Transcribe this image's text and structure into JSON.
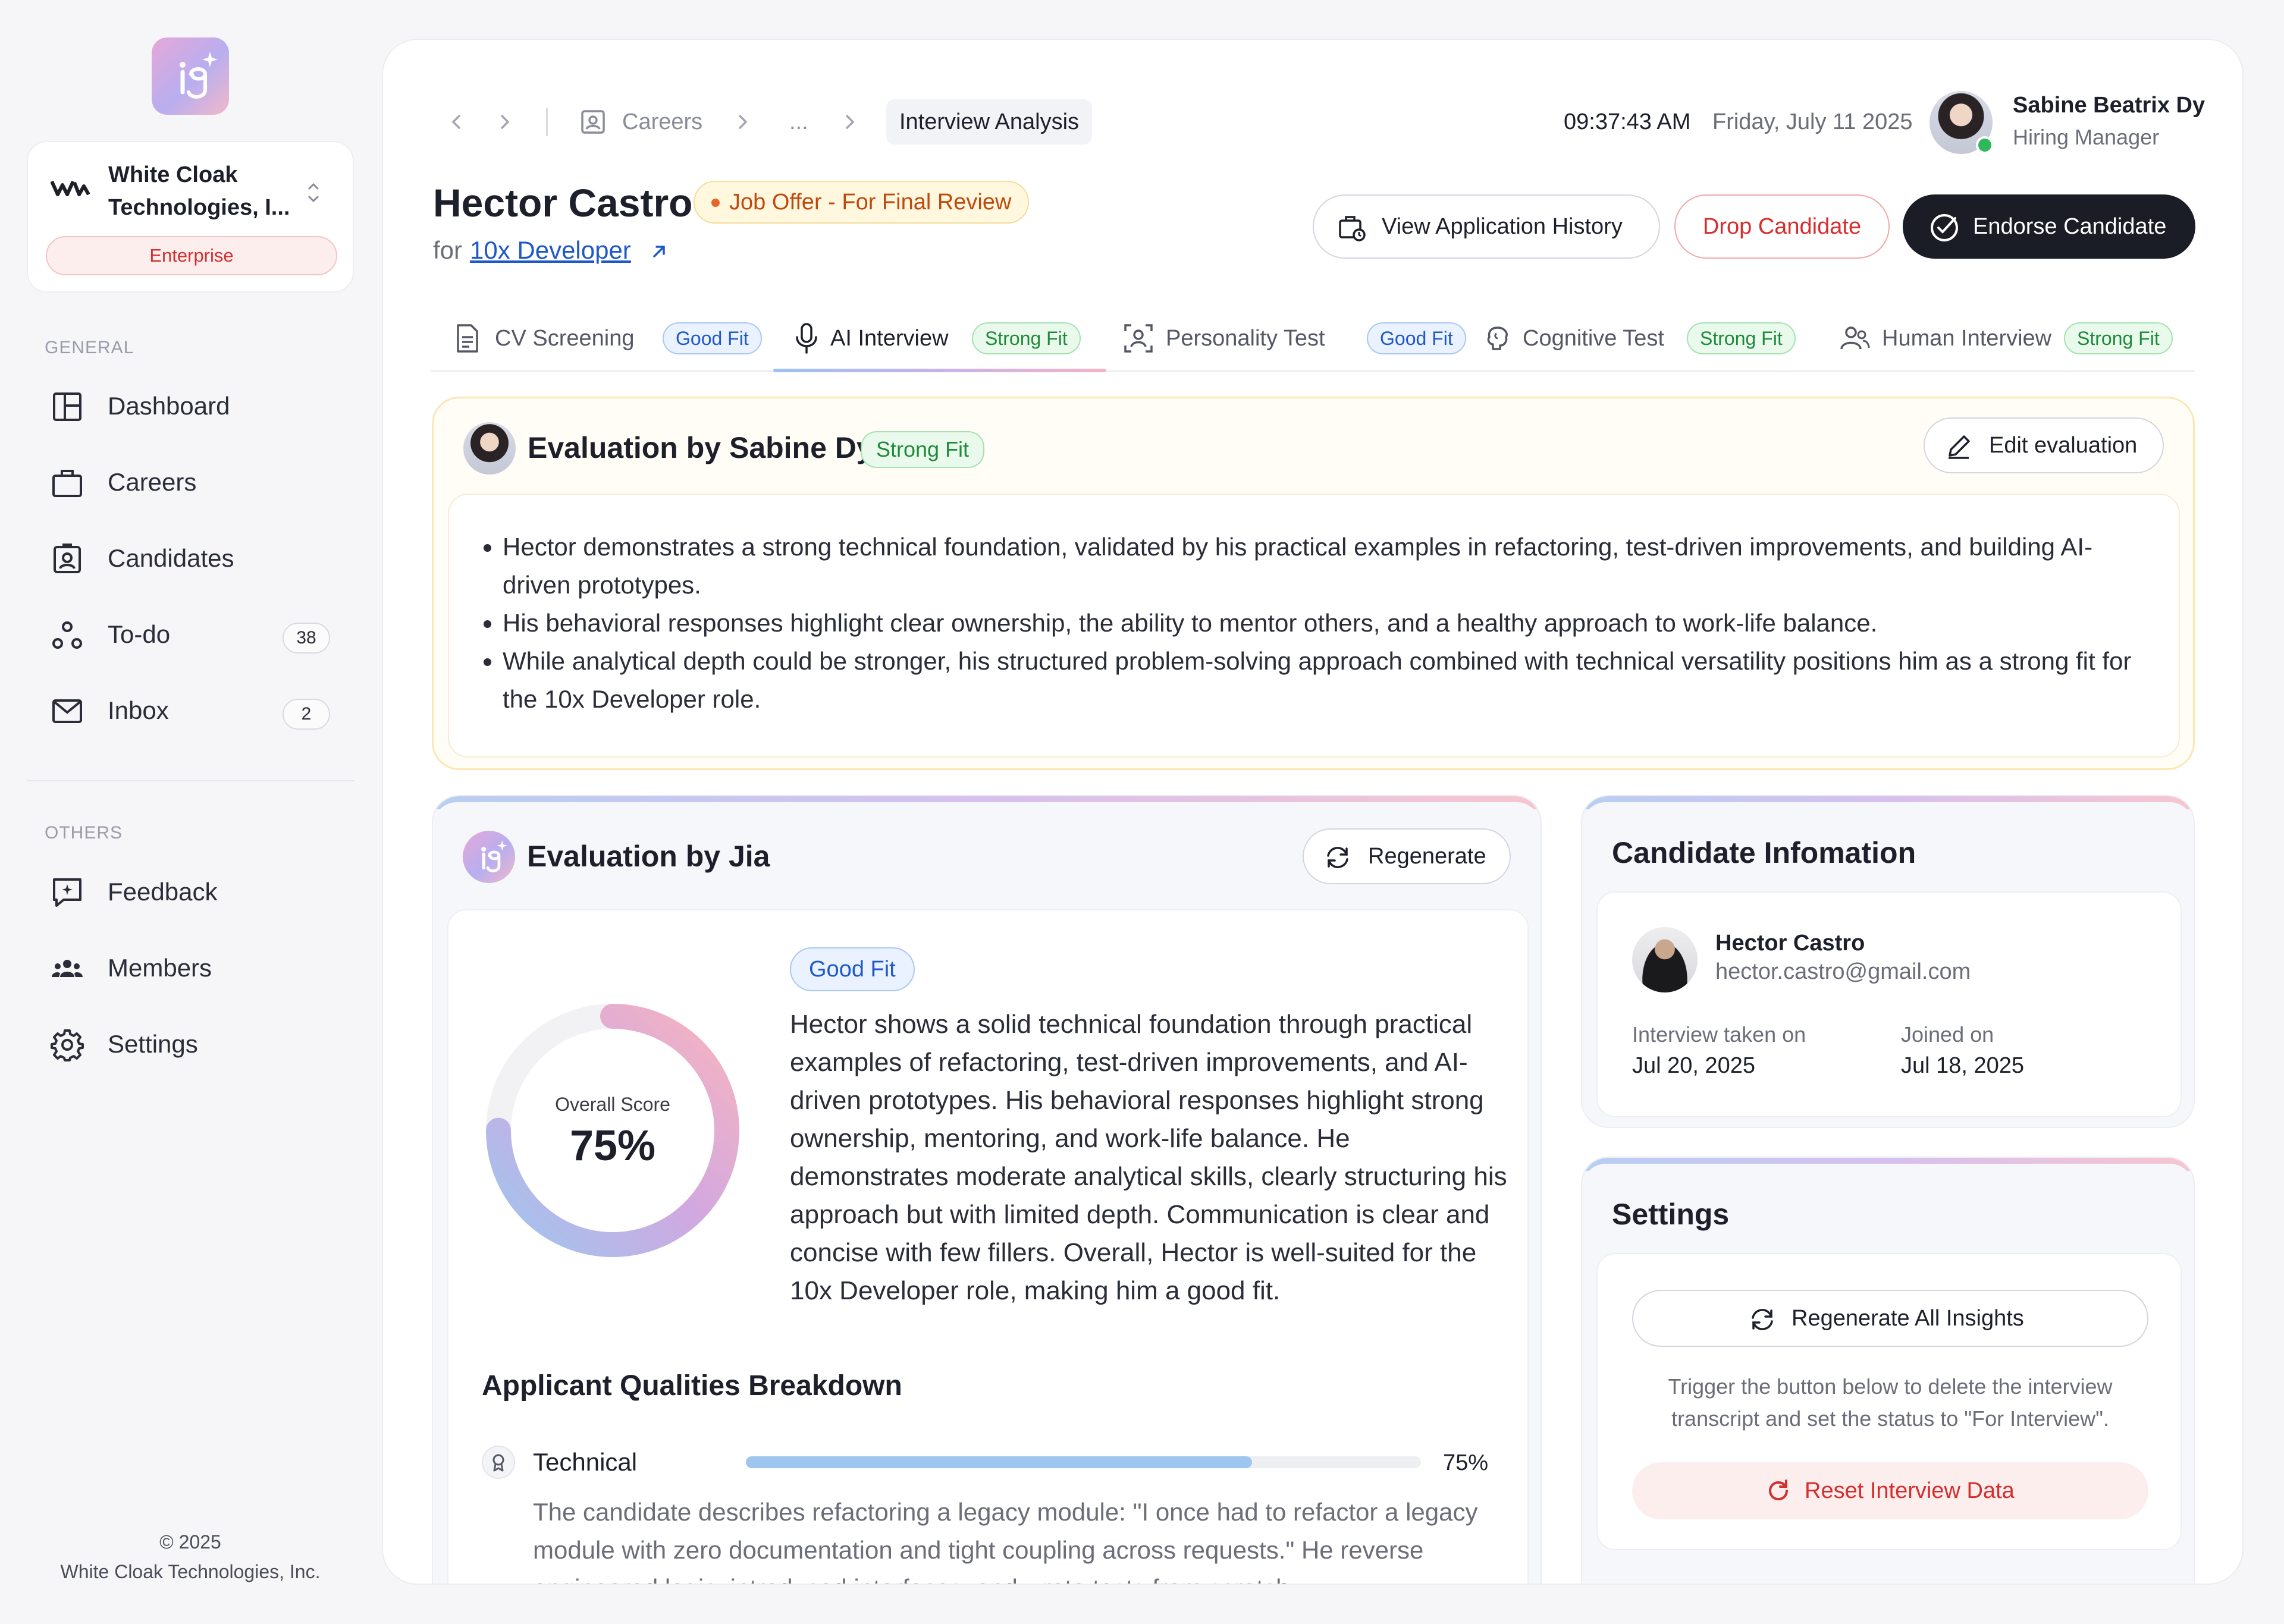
{
  "sidebar": {
    "org_name": "White Cloak Technologies, I...",
    "org_plan": "Enterprise",
    "general_label": "GENERAL",
    "others_label": "OTHERS",
    "general_items": [
      {
        "label": "Dashboard",
        "icon": "dashboard-icon"
      },
      {
        "label": "Careers",
        "icon": "briefcase-icon"
      },
      {
        "label": "Candidates",
        "icon": "candidates-icon"
      },
      {
        "label": "To-do",
        "icon": "todo-icon",
        "count": "38"
      },
      {
        "label": "Inbox",
        "icon": "mail-icon",
        "count": "2"
      }
    ],
    "other_items": [
      {
        "label": "Feedback",
        "icon": "feedback-icon"
      },
      {
        "label": "Members",
        "icon": "members-icon"
      },
      {
        "label": "Settings",
        "icon": "gear-icon"
      }
    ],
    "copyright_year": "© 2025",
    "copyright_company": "White Cloak Technologies, Inc."
  },
  "header": {
    "breadcrumb": [
      "Careers",
      "...",
      "Interview Analysis"
    ],
    "time": "09:37:43 AM",
    "date": "Friday, July 11 2025",
    "user_name": "Sabine Beatrix Dy",
    "user_role": "Hiring Manager"
  },
  "candidate": {
    "name": "Hector Castro",
    "status": "Job Offer - For Final Review",
    "for_label": "for",
    "role": "10x Developer"
  },
  "actions": {
    "history": "View Application History",
    "drop": "Drop Candidate",
    "endorse": "Endorse Candidate"
  },
  "tabs": [
    {
      "label": "CV Screening",
      "tag": "Good Fit",
      "icon": "document-icon"
    },
    {
      "label": "AI Interview",
      "tag": "Strong Fit",
      "icon": "microphone-icon"
    },
    {
      "label": "Personality Test",
      "tag": "Good Fit",
      "icon": "personality-icon"
    },
    {
      "label": "Cognitive Test",
      "tag": "Strong Fit",
      "icon": "brain-icon"
    },
    {
      "label": "Human Interview",
      "tag": "Strong Fit",
      "icon": "people-icon"
    }
  ],
  "evaluation_human": {
    "title": "Evaluation by Sabine Dy",
    "tag": "Strong Fit",
    "edit_label": "Edit evaluation",
    "bullets": [
      "Hector demonstrates a strong technical foundation, validated by his practical examples in refactoring, test-driven improvements, and building AI-driven prototypes.",
      "His behavioral responses highlight clear ownership, the ability to mentor others, and a healthy approach to work-life balance.",
      "While analytical depth could be stronger, his structured problem-solving approach combined with technical versatility positions him as a strong fit for the 10x Developer role."
    ]
  },
  "evaluation_ai": {
    "title": "Evaluation by Jia",
    "regenerate_label": "Regenerate",
    "tag": "Good Fit",
    "score_label": "Overall Score",
    "score_text": "75%",
    "score_value": 75,
    "summary": "Hector shows a solid technical foundation through practical examples of refactoring, test-driven improvements, and AI-driven prototypes. His behavioral responses highlight strong ownership, mentoring, and work-life balance. He demonstrates moderate analytical skills, clearly structuring his approach but with limited depth. Communication is clear and concise with few fillers. Overall, Hector is well-suited for the 10x Developer role, making him a good fit.",
    "breakdown_title": "Applicant Qualities Breakdown",
    "qualities": [
      {
        "label": "Technical",
        "percent_text": "75%",
        "percent": 75,
        "text": "The candidate describes refactoring a legacy module: \"I once had to refactor a legacy module with zero documentation and tight coupling across requests.\" He reverse engineered logic, introduced interfaces, and wrote tests from scratch."
      }
    ]
  },
  "candidate_info": {
    "title": "Candidate Infomation",
    "name": "Hector Castro",
    "email": "hector.castro@gmail.com",
    "interview_label": "Interview taken on",
    "interview_date": "Jul 20, 2025",
    "joined_label": "Joined on",
    "joined_date": "Jul 18, 2025"
  },
  "settings": {
    "title": "Settings",
    "regen_all": "Regenerate All Insights",
    "note": "Trigger the button below to delete the interview transcript and set the status to \"For Interview\".",
    "reset": "Reset Interview Data"
  },
  "colors": {
    "accent_blue": "#1f58c9",
    "strong_green": "#1f8a3a",
    "danger_red": "#d62d2d",
    "status_orange": "#c0490d",
    "dark": "#1a1c26"
  }
}
